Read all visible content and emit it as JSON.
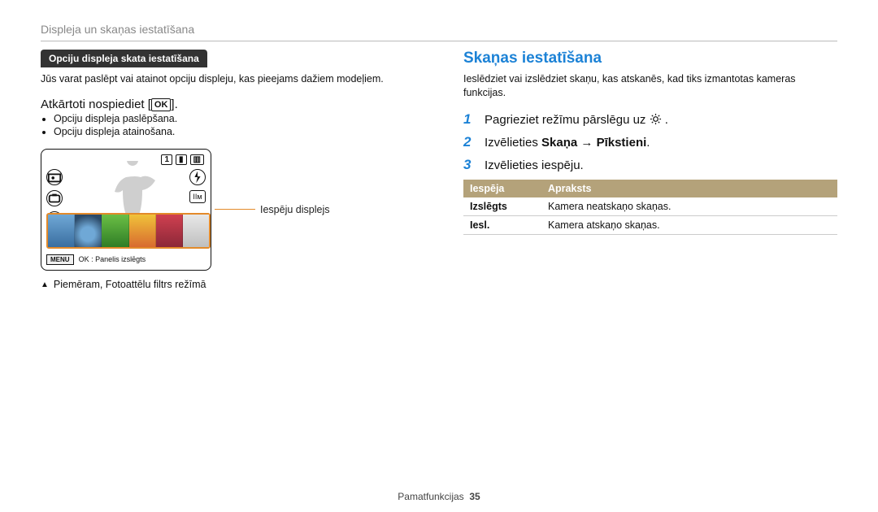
{
  "header": {
    "section_title": "Displeja un skaņas iestatīšana"
  },
  "left": {
    "pill": "Opciju displeja skata iestatīšana",
    "intro": "Jūs varat paslēpt vai atainot opciju displeju, kas pieejams dažiem modeļiem.",
    "repeat_press_prefix": "Atkārtoti nospiediet [",
    "repeat_press_ok": "OK",
    "repeat_press_suffix": "].",
    "bullets": [
      "Opciju displeja paslēpšana.",
      "Opciju displeja atainošana."
    ],
    "device": {
      "count_badge": "1",
      "menu_label": "MENU",
      "ok_panel_text": "OK : Panelis izslēgts"
    },
    "leader_label": "Iespēju displejs",
    "caption": "Piemēram, Fotoattēlu filtrs režīmā"
  },
  "right": {
    "title": "Skaņas iestatīšana",
    "intro": "Ieslēdziet vai izslēdziet skaņu, kas atskanēs, kad tiks izmantotas kameras funkcijas.",
    "steps": [
      {
        "prefix": "Pagrieziet režīmu pārslēgu uz ",
        "gear": true,
        "suffix": " ."
      },
      {
        "prefix": "Izvēlieties ",
        "bold1": "Skaņa",
        "arrow": " → ",
        "bold2": "Pīkstieni",
        "suffix": "."
      },
      {
        "prefix": "Izvēlieties iespēju."
      }
    ],
    "table": {
      "headers": [
        "Iespēja",
        "Apraksts"
      ],
      "rows": [
        {
          "key": "Izslēgts",
          "val": "Kamera neatskaņo skaņas."
        },
        {
          "key": "Iesl.",
          "val": "Kamera atskaņo skaņas."
        }
      ]
    }
  },
  "footer": {
    "label": "Pamatfunkcijas",
    "page": "35"
  }
}
